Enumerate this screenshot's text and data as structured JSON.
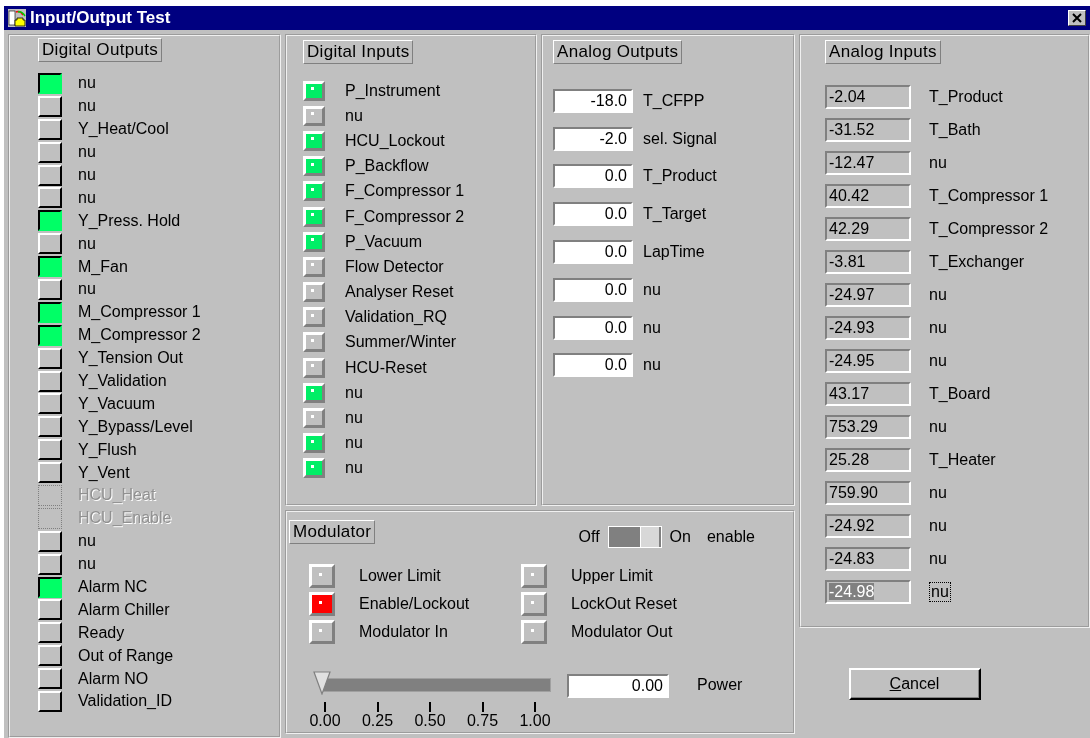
{
  "window": {
    "title": "Input/Output Test"
  },
  "digital_outputs": {
    "title": "Digital Outputs",
    "items": [
      {
        "label": "nu",
        "on": true,
        "disabled": false
      },
      {
        "label": "nu",
        "on": false,
        "disabled": false
      },
      {
        "label": "Y_Heat/Cool",
        "on": false,
        "disabled": false
      },
      {
        "label": "nu",
        "on": false,
        "disabled": false
      },
      {
        "label": "nu",
        "on": false,
        "disabled": false
      },
      {
        "label": "nu",
        "on": false,
        "disabled": false
      },
      {
        "label": "Y_Press. Hold",
        "on": true,
        "disabled": false
      },
      {
        "label": "nu",
        "on": false,
        "disabled": false
      },
      {
        "label": "M_Fan",
        "on": true,
        "disabled": false
      },
      {
        "label": "nu",
        "on": false,
        "disabled": false
      },
      {
        "label": "M_Compressor 1",
        "on": true,
        "disabled": false
      },
      {
        "label": "M_Compressor 2",
        "on": true,
        "disabled": false
      },
      {
        "label": "Y_Tension Out",
        "on": false,
        "disabled": false
      },
      {
        "label": "Y_Validation",
        "on": false,
        "disabled": false
      },
      {
        "label": "Y_Vacuum",
        "on": false,
        "disabled": false
      },
      {
        "label": "Y_Bypass/Level",
        "on": false,
        "disabled": false
      },
      {
        "label": "Y_Flush",
        "on": false,
        "disabled": false
      },
      {
        "label": "Y_Vent",
        "on": false,
        "disabled": false
      },
      {
        "label": "HCU_Heat",
        "on": false,
        "disabled": true
      },
      {
        "label": "HCU_Enable",
        "on": false,
        "disabled": true
      },
      {
        "label": "nu",
        "on": false,
        "disabled": false
      },
      {
        "label": "nu",
        "on": false,
        "disabled": false
      },
      {
        "label": "Alarm NC",
        "on": true,
        "disabled": false
      },
      {
        "label": "Alarm Chiller",
        "on": false,
        "disabled": false
      },
      {
        "label": "Ready",
        "on": false,
        "disabled": false
      },
      {
        "label": "Out of Range",
        "on": false,
        "disabled": false
      },
      {
        "label": "Alarm NO",
        "on": false,
        "disabled": false
      },
      {
        "label": "Validation_ID",
        "on": false,
        "disabled": false
      }
    ]
  },
  "digital_inputs": {
    "title": "Digital Inputs",
    "items": [
      {
        "label": "P_Instrument",
        "on": true
      },
      {
        "label": "nu",
        "on": false
      },
      {
        "label": "HCU_Lockout",
        "on": true
      },
      {
        "label": "P_Backflow",
        "on": true
      },
      {
        "label": "F_Compressor 1",
        "on": true
      },
      {
        "label": "F_Compressor 2",
        "on": true
      },
      {
        "label": "P_Vacuum",
        "on": true
      },
      {
        "label": "Flow Detector",
        "on": false
      },
      {
        "label": "Analyser Reset",
        "on": false
      },
      {
        "label": "Validation_RQ",
        "on": false
      },
      {
        "label": "Summer/Winter",
        "on": false
      },
      {
        "label": "HCU-Reset",
        "on": false
      },
      {
        "label": "nu",
        "on": true
      },
      {
        "label": "nu",
        "on": false
      },
      {
        "label": "nu",
        "on": true
      },
      {
        "label": "nu",
        "on": true
      }
    ]
  },
  "analog_outputs": {
    "title": "Analog Outputs",
    "items": [
      {
        "value": "-18.0",
        "label": "T_CFPP"
      },
      {
        "value": "-2.0",
        "label": "sel. Signal"
      },
      {
        "value": "0.0",
        "label": "T_Product"
      },
      {
        "value": "0.0",
        "label": "T_Target"
      },
      {
        "value": "0.0",
        "label": "LapTime"
      },
      {
        "value": "0.0",
        "label": "nu"
      },
      {
        "value": "0.0",
        "label": "nu"
      },
      {
        "value": "0.0",
        "label": "nu"
      }
    ]
  },
  "analog_inputs": {
    "title": "Analog Inputs",
    "items": [
      {
        "value": "-2.04",
        "label": "T_Product",
        "selected": false
      },
      {
        "value": "-31.52",
        "label": "T_Bath",
        "selected": false
      },
      {
        "value": "-12.47",
        "label": "nu",
        "selected": false
      },
      {
        "value": "40.42",
        "label": "T_Compressor 1",
        "selected": false
      },
      {
        "value": "42.29",
        "label": "T_Compressor 2",
        "selected": false
      },
      {
        "value": "-3.81",
        "label": "T_Exchanger",
        "selected": false
      },
      {
        "value": "-24.97",
        "label": "nu",
        "selected": false
      },
      {
        "value": "-24.93",
        "label": "nu",
        "selected": false
      },
      {
        "value": "-24.95",
        "label": "nu",
        "selected": false
      },
      {
        "value": "43.17",
        "label": "T_Board",
        "selected": false
      },
      {
        "value": "753.29",
        "label": "nu",
        "selected": false
      },
      {
        "value": "25.28",
        "label": "T_Heater",
        "selected": false
      },
      {
        "value": "759.90",
        "label": "nu",
        "selected": false
      },
      {
        "value": "-24.92",
        "label": "nu",
        "selected": false
      },
      {
        "value": "-24.83",
        "label": "nu",
        "selected": false
      },
      {
        "value": "-24.98",
        "label": "nu",
        "selected": true
      }
    ]
  },
  "modulator": {
    "title": "Modulator",
    "switch": {
      "off_label": "Off",
      "on_label": "On",
      "label": "enable",
      "on": true
    },
    "indicators": [
      {
        "label": "Lower Limit",
        "on": false
      },
      {
        "label": "Upper Limit",
        "on": false
      },
      {
        "label": "Enable/Lockout",
        "on": true
      },
      {
        "label": "LockOut Reset",
        "on": false
      },
      {
        "label": "Modulator In",
        "on": false
      },
      {
        "label": "Modulator Out",
        "on": false
      }
    ],
    "slider": {
      "level": 0,
      "ticks": [
        "0.00",
        "0.25",
        "0.50",
        "0.75",
        "1.00"
      ]
    },
    "power": {
      "value": "0.00",
      "label": "Power"
    }
  },
  "cancel_button": {
    "label": "Cancel",
    "first_letter_underlined": true
  }
}
